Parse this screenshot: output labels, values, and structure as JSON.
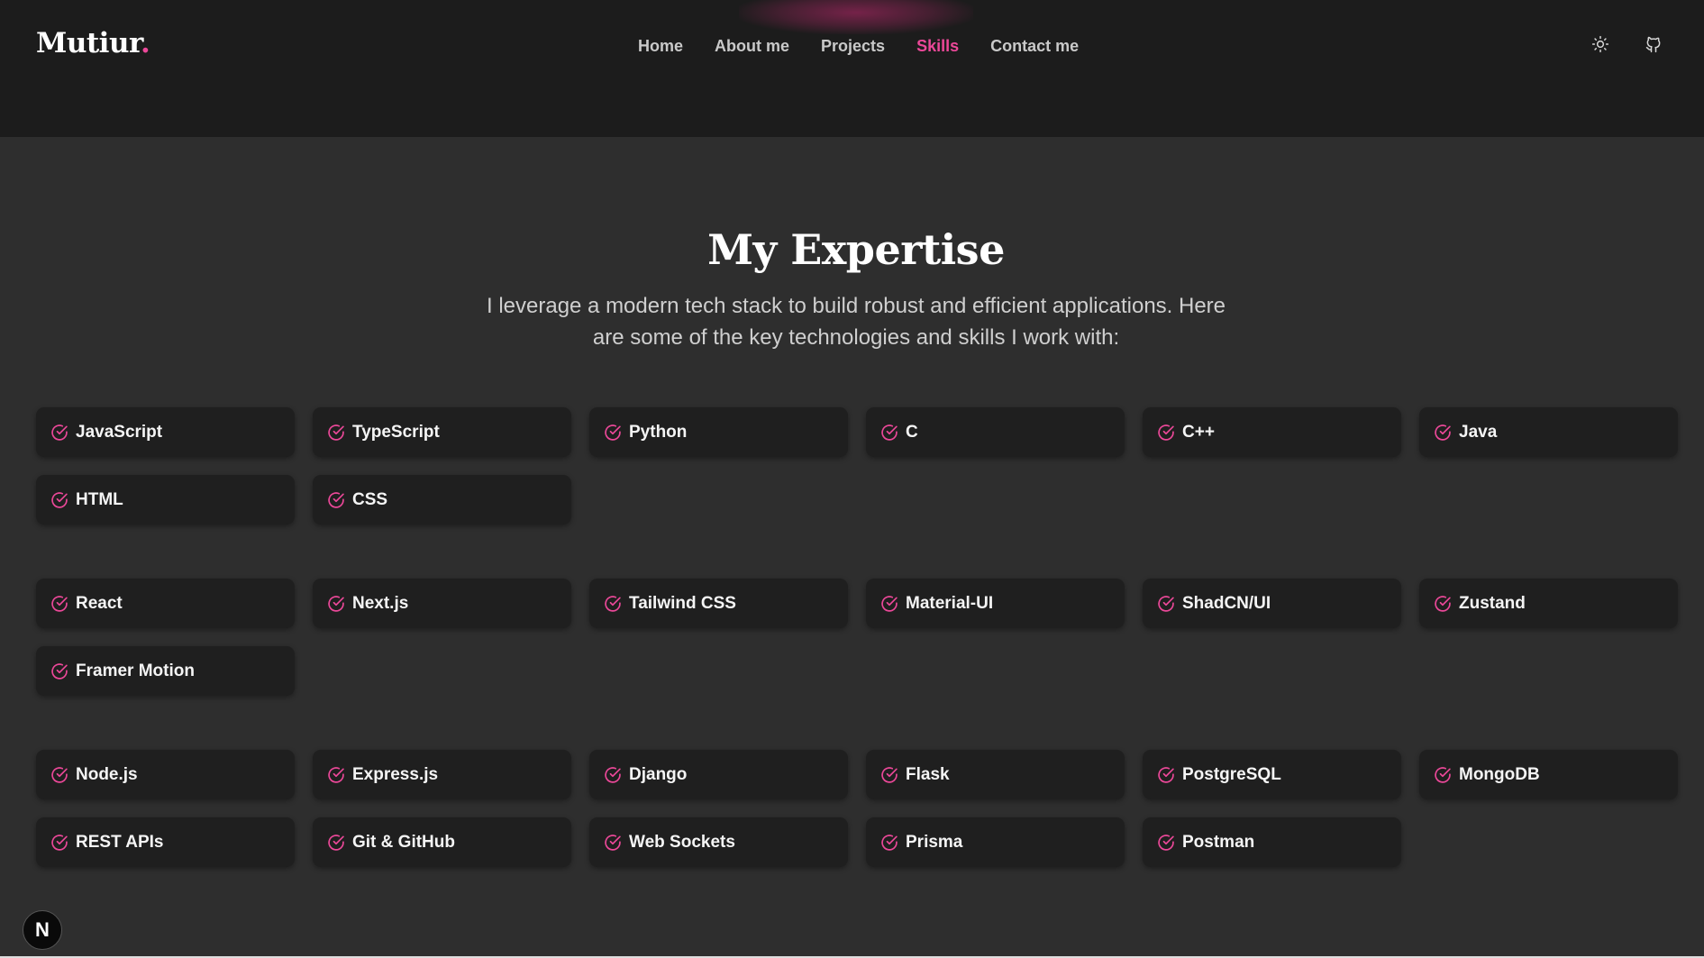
{
  "brand": {
    "name": "Mutiur",
    "dot": "."
  },
  "nav": [
    {
      "label": "Home",
      "active": false
    },
    {
      "label": "About me",
      "active": false
    },
    {
      "label": "Projects",
      "active": false
    },
    {
      "label": "Skills",
      "active": true
    },
    {
      "label": "Contact me",
      "active": false
    }
  ],
  "header_icons": [
    "sun-icon",
    "github-icon"
  ],
  "accent_color": "#ec4899",
  "section": {
    "title": "My Expertise",
    "subtitle": "I leverage a modern tech stack to build robust and efficient applications. Here are some of the key technologies and skills I work with:"
  },
  "skill_groups": [
    [
      "JavaScript",
      "TypeScript",
      "Python",
      "C",
      "C++",
      "Java",
      "HTML",
      "CSS"
    ],
    [
      "React",
      "Next.js",
      "Tailwind CSS",
      "Material-UI",
      "ShadCN/UI",
      "Zustand",
      "Framer Motion"
    ],
    [
      "Node.js",
      "Express.js",
      "Django",
      "Flask",
      "PostgreSQL",
      "MongoDB",
      "REST APIs",
      "Git & GitHub",
      "Web Sockets",
      "Prisma",
      "Postman"
    ]
  ],
  "badge": {
    "letter": "N"
  }
}
